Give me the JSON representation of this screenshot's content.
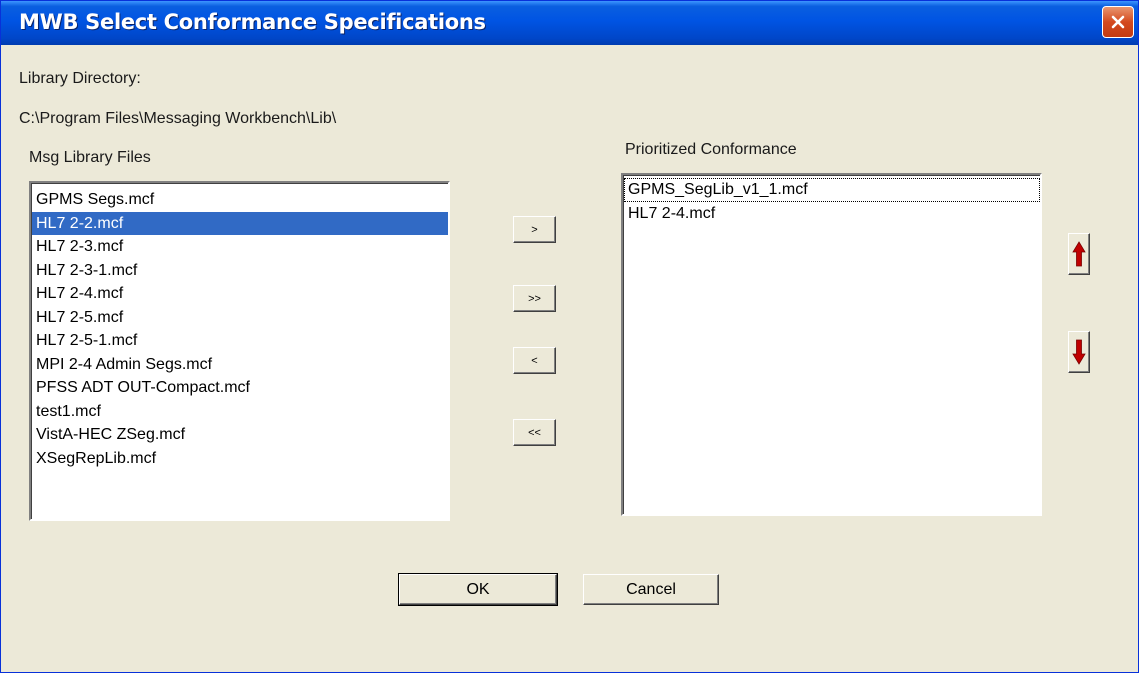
{
  "window": {
    "title": "MWB Select Conformance Specifications"
  },
  "library": {
    "directory_label": "Library Directory:",
    "directory_path": "C:\\Program Files\\Messaging Workbench\\Lib\\"
  },
  "msg_library": {
    "label": "Msg Library Files",
    "items": [
      {
        "label": "GPMS Segs.mcf",
        "selected": false
      },
      {
        "label": "HL7 2-2.mcf",
        "selected": true
      },
      {
        "label": "HL7 2-3.mcf",
        "selected": false
      },
      {
        "label": "HL7 2-3-1.mcf",
        "selected": false
      },
      {
        "label": "HL7 2-4.mcf",
        "selected": false
      },
      {
        "label": "HL7 2-5.mcf",
        "selected": false
      },
      {
        "label": "HL7 2-5-1.mcf",
        "selected": false
      },
      {
        "label": "MPI 2-4 Admin Segs.mcf",
        "selected": false
      },
      {
        "label": "PFSS ADT OUT-Compact.mcf",
        "selected": false
      },
      {
        "label": "test1.mcf",
        "selected": false
      },
      {
        "label": "VistA-HEC ZSeg.mcf",
        "selected": false
      },
      {
        "label": "XSegRepLib.mcf",
        "selected": false
      }
    ]
  },
  "transfer_buttons": {
    "add": ">",
    "add_all": ">>",
    "remove": "<",
    "remove_all": "<<"
  },
  "prioritized": {
    "label": "Prioritized Conformance",
    "items": [
      {
        "label": "GPMS_SegLib_v1_1.mcf",
        "focused": true
      },
      {
        "label": "HL7 2-4.mcf",
        "focused": false
      }
    ]
  },
  "order_buttons": {
    "move_up_icon": "red-up-arrow-icon",
    "move_down_icon": "red-down-arrow-icon",
    "arrow_color": "#c00000"
  },
  "footer": {
    "ok_label": "OK",
    "cancel_label": "Cancel"
  },
  "colors": {
    "title_bar": "#0054e3",
    "selection": "#316ac5",
    "dialog_bg": "#ece9d8"
  }
}
